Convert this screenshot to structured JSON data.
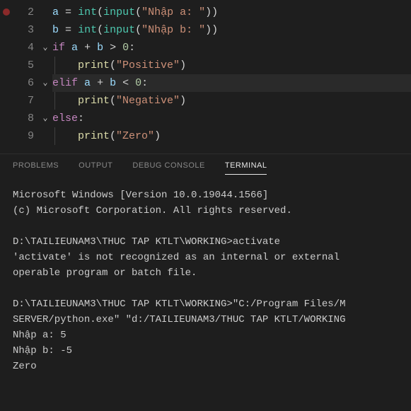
{
  "editor": {
    "lines": [
      {
        "num": "2",
        "fold": "",
        "highlighted": false,
        "breakpoint": true,
        "indent": 0,
        "tokens": [
          {
            "t": "a",
            "c": "tk-var"
          },
          {
            "t": " ",
            "c": ""
          },
          {
            "t": "=",
            "c": "tk-op"
          },
          {
            "t": " ",
            "c": ""
          },
          {
            "t": "int",
            "c": "tk-builtin"
          },
          {
            "t": "(",
            "c": "tk-paren"
          },
          {
            "t": "input",
            "c": "tk-builtin"
          },
          {
            "t": "(",
            "c": "tk-paren"
          },
          {
            "t": "\"Nhập a: \"",
            "c": "tk-str"
          },
          {
            "t": ")",
            "c": "tk-paren"
          },
          {
            "t": ")",
            "c": "tk-paren"
          }
        ]
      },
      {
        "num": "3",
        "fold": "",
        "highlighted": false,
        "breakpoint": false,
        "indent": 0,
        "tokens": [
          {
            "t": "b",
            "c": "tk-var"
          },
          {
            "t": " ",
            "c": ""
          },
          {
            "t": "=",
            "c": "tk-op"
          },
          {
            "t": " ",
            "c": ""
          },
          {
            "t": "int",
            "c": "tk-builtin"
          },
          {
            "t": "(",
            "c": "tk-paren"
          },
          {
            "t": "input",
            "c": "tk-builtin"
          },
          {
            "t": "(",
            "c": "tk-paren"
          },
          {
            "t": "\"Nhập b: \"",
            "c": "tk-str"
          },
          {
            "t": ")",
            "c": "tk-paren"
          },
          {
            "t": ")",
            "c": "tk-paren"
          }
        ]
      },
      {
        "num": "4",
        "fold": "⌄",
        "highlighted": false,
        "breakpoint": false,
        "indent": 0,
        "tokens": [
          {
            "t": "if",
            "c": "tk-kw"
          },
          {
            "t": " ",
            "c": ""
          },
          {
            "t": "a",
            "c": "tk-var"
          },
          {
            "t": " ",
            "c": ""
          },
          {
            "t": "+",
            "c": "tk-op"
          },
          {
            "t": " ",
            "c": ""
          },
          {
            "t": "b",
            "c": "tk-var"
          },
          {
            "t": " ",
            "c": ""
          },
          {
            "t": ">",
            "c": "tk-op"
          },
          {
            "t": " ",
            "c": ""
          },
          {
            "t": "0",
            "c": "tk-num"
          },
          {
            "t": ":",
            "c": "tk-op"
          }
        ]
      },
      {
        "num": "5",
        "fold": "",
        "highlighted": false,
        "breakpoint": false,
        "indent": 1,
        "tokens": [
          {
            "t": "    ",
            "c": ""
          },
          {
            "t": "print",
            "c": "tk-func"
          },
          {
            "t": "(",
            "c": "tk-paren"
          },
          {
            "t": "\"Positive\"",
            "c": "tk-str"
          },
          {
            "t": ")",
            "c": "tk-paren"
          }
        ]
      },
      {
        "num": "6",
        "fold": "⌄",
        "highlighted": true,
        "breakpoint": false,
        "indent": 0,
        "tokens": [
          {
            "t": "elif",
            "c": "tk-kw"
          },
          {
            "t": " ",
            "c": ""
          },
          {
            "t": "a",
            "c": "tk-var"
          },
          {
            "t": " ",
            "c": ""
          },
          {
            "t": "+",
            "c": "tk-op"
          },
          {
            "t": " ",
            "c": ""
          },
          {
            "t": "b",
            "c": "tk-var"
          },
          {
            "t": " ",
            "c": ""
          },
          {
            "t": "<",
            "c": "tk-op"
          },
          {
            "t": " ",
            "c": ""
          },
          {
            "t": "0",
            "c": "tk-num"
          },
          {
            "t": ":",
            "c": "tk-op"
          }
        ]
      },
      {
        "num": "7",
        "fold": "",
        "highlighted": false,
        "breakpoint": false,
        "indent": 1,
        "tokens": [
          {
            "t": "    ",
            "c": ""
          },
          {
            "t": "print",
            "c": "tk-func"
          },
          {
            "t": "(",
            "c": "tk-paren"
          },
          {
            "t": "\"Negative\"",
            "c": "tk-str"
          },
          {
            "t": ")",
            "c": "tk-paren"
          }
        ]
      },
      {
        "num": "8",
        "fold": "⌄",
        "highlighted": false,
        "breakpoint": false,
        "indent": 0,
        "tokens": [
          {
            "t": "else",
            "c": "tk-kw"
          },
          {
            "t": ":",
            "c": "tk-op"
          }
        ]
      },
      {
        "num": "9",
        "fold": "",
        "highlighted": false,
        "breakpoint": false,
        "indent": 1,
        "tokens": [
          {
            "t": "    ",
            "c": ""
          },
          {
            "t": "print",
            "c": "tk-func"
          },
          {
            "t": "(",
            "c": "tk-paren"
          },
          {
            "t": "\"Zero\"",
            "c": "tk-str"
          },
          {
            "t": ")",
            "c": "tk-paren"
          }
        ]
      }
    ]
  },
  "panel": {
    "tabs": [
      {
        "label": "PROBLEMS",
        "active": false
      },
      {
        "label": "OUTPUT",
        "active": false
      },
      {
        "label": "DEBUG CONSOLE",
        "active": false
      },
      {
        "label": "TERMINAL",
        "active": true
      }
    ]
  },
  "terminal": {
    "lines": [
      "Microsoft Windows [Version 10.0.19044.1566]",
      "(c) Microsoft Corporation. All rights reserved.",
      "",
      "D:\\TAILIEUNAM3\\THUC TAP KTLT\\WORKING>activate",
      "'activate' is not recognized as an internal or external ",
      "operable program or batch file.",
      "",
      "D:\\TAILIEUNAM3\\THUC TAP KTLT\\WORKING>\"C:/Program Files/M",
      "SERVER/python.exe\" \"d:/TAILIEUNAM3/THUC TAP KTLT/WORKING",
      "Nhập a: 5",
      "Nhập b: -5",
      "Zero"
    ]
  }
}
